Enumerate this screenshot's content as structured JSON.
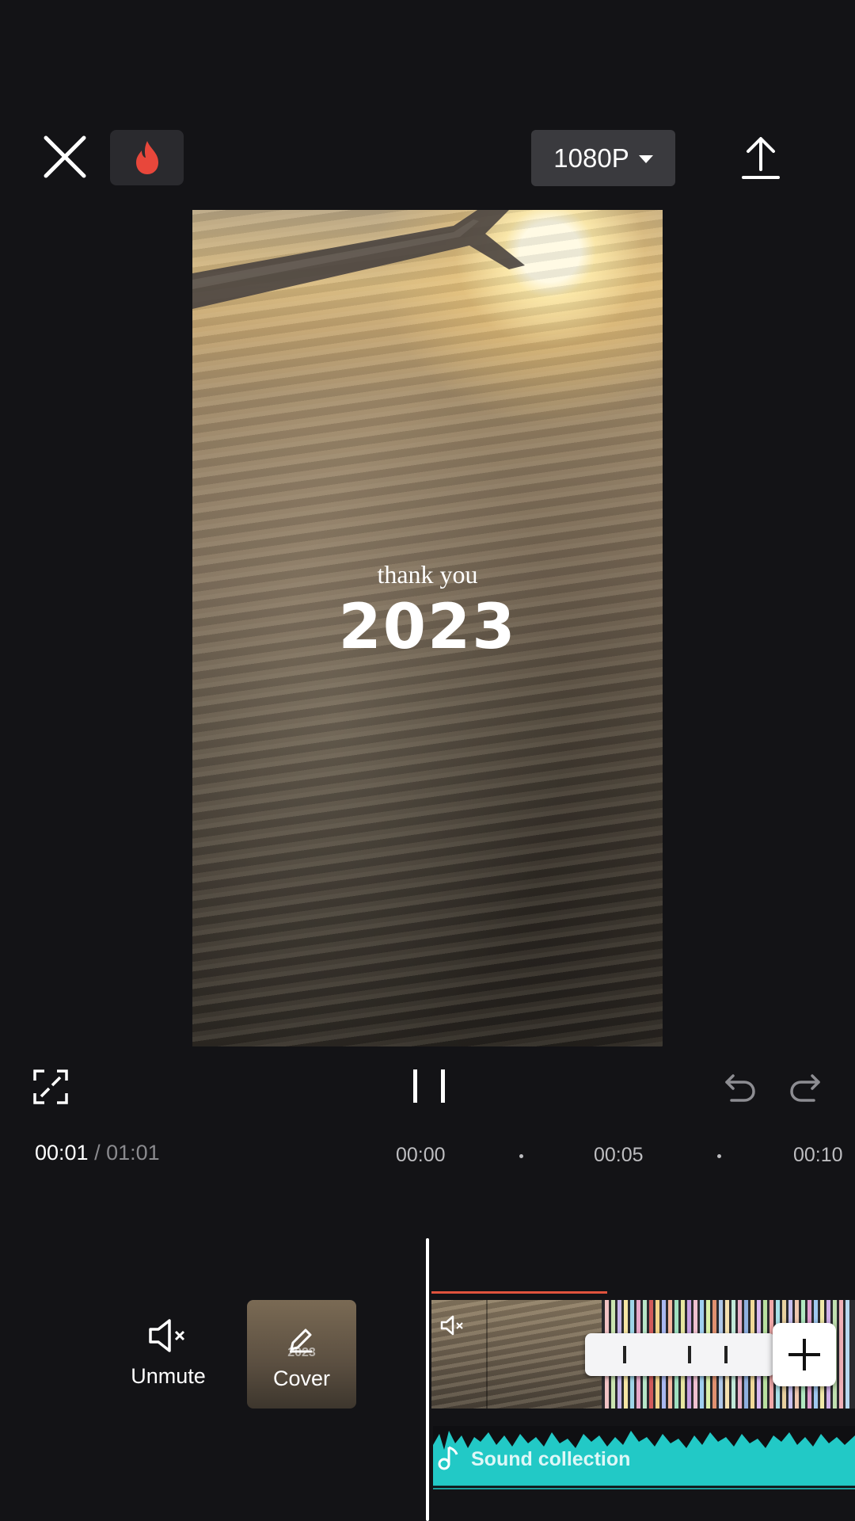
{
  "toolbar": {
    "resolution": "1080P"
  },
  "preview": {
    "subtitle": "thank you",
    "title": "2023"
  },
  "timeline": {
    "current_time": "00:01",
    "separator": "/",
    "total_time": "01:01",
    "ticks": [
      "00:00",
      "00:05",
      "00:10"
    ]
  },
  "tools": {
    "unmute_label": "Unmute",
    "cover_label": "Cover",
    "cover_thumb_text": "2023"
  },
  "audio": {
    "label": "Sound collection"
  },
  "colors": {
    "accent_audio": "#22c9c6",
    "trim_line": "#e0533d",
    "fire_icon": "#e8473b"
  }
}
